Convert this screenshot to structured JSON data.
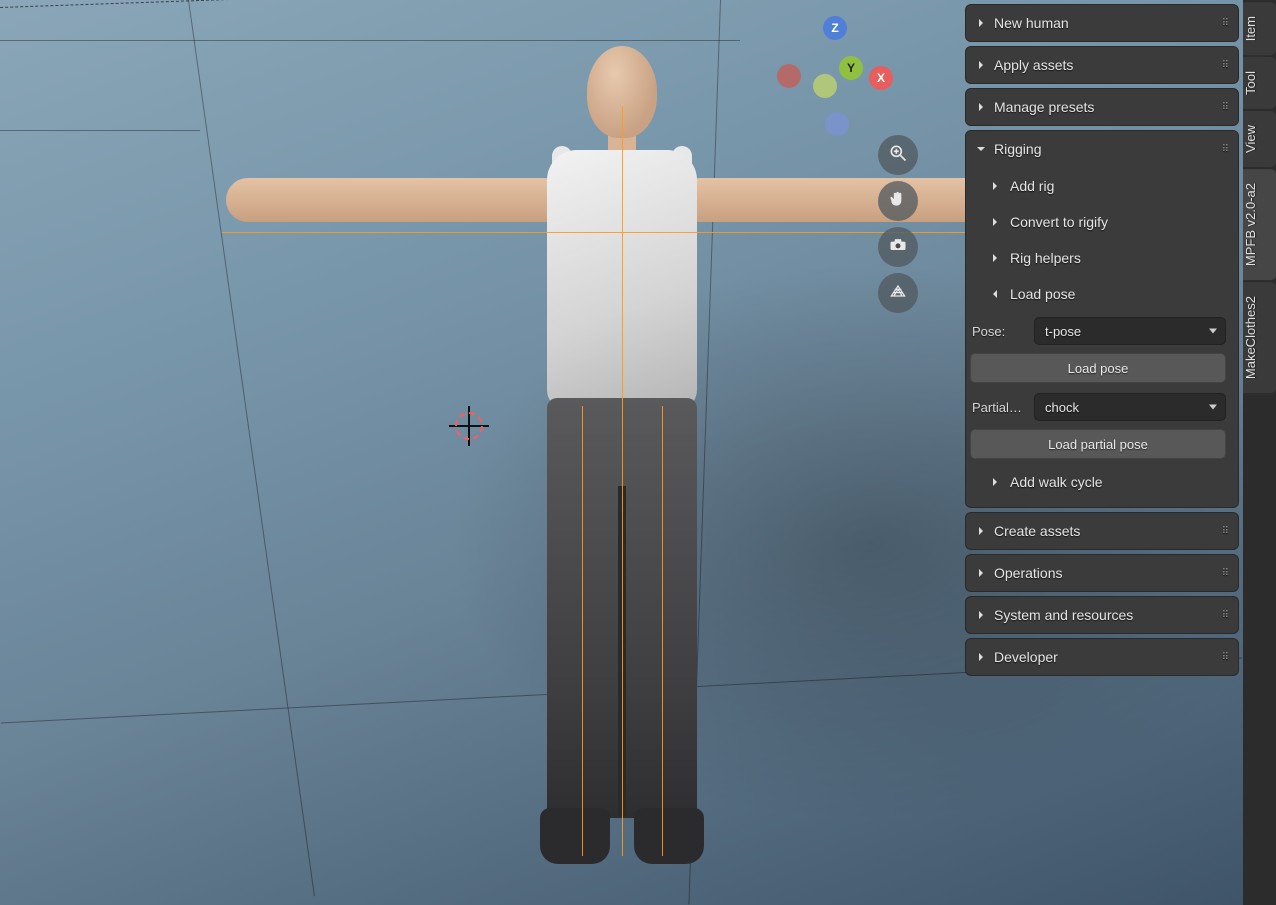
{
  "gizmo": {
    "x": "X",
    "y": "Y",
    "z": "Z"
  },
  "panels": {
    "new_human": "New human",
    "apply_assets": "Apply assets",
    "manage_presets": "Manage presets",
    "rigging": "Rigging",
    "create_assets": "Create assets",
    "operations": "Operations",
    "system": "System and resources",
    "developer": "Developer"
  },
  "rigging": {
    "add_rig": "Add rig",
    "convert_rigify": "Convert to rigify",
    "rig_helpers": "Rig helpers",
    "load_pose": "Load pose",
    "add_walk_cycle": "Add walk cycle",
    "pose_label": "Pose:",
    "pose_value": "t-pose",
    "load_pose_btn": "Load pose",
    "partial_label": "Partial…",
    "partial_value": "chock",
    "load_partial_btn": "Load partial pose"
  },
  "tabs": {
    "item": "Item",
    "tool": "Tool",
    "view": "View",
    "mpfb": "MPFB v2.0-a2",
    "makeclothes": "MakeClothes2"
  }
}
